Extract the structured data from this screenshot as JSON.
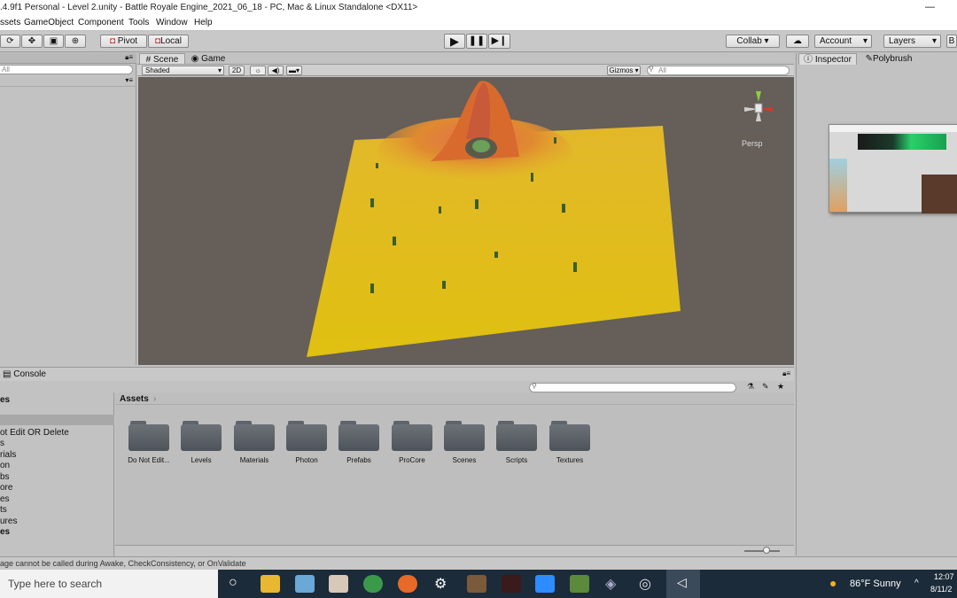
{
  "window": {
    "title": ".4.9f1 Personal - Level 2.unity - Battle Royale Engine_2021_06_18 - PC, Mac & Linux Standalone <DX11>",
    "minimize": "—",
    "maximize": "☐"
  },
  "menu": {
    "items": [
      "ssets",
      "GameObject",
      "Component",
      "Tools",
      "Window",
      "Help"
    ]
  },
  "toolbar": {
    "pivot": "Pivot",
    "local": "Local",
    "collab": "Collab ▾",
    "account": "Account",
    "layers": "Layers",
    "layout": "B"
  },
  "hierarchy": {
    "search_placeholder": "All"
  },
  "scene": {
    "tab_scene": "Scene",
    "tab_game": "Game",
    "shading": "Shaded",
    "mode_2d": "2D",
    "gizmos": "Gizmos",
    "search_placeholder": "All",
    "persp": "Persp"
  },
  "inspector": {
    "tab_inspector": "Inspector",
    "tab_polybrush": "Polybrush"
  },
  "console": {
    "tab": "Console"
  },
  "project": {
    "root": "es",
    "breadcrumb": "Assets",
    "tree": [
      "ot Edit OR Delete",
      "s",
      "rials",
      "on",
      "bs",
      "ore",
      "es",
      "ts",
      "ures",
      "es"
    ],
    "folders": [
      "Do Not Edit...",
      "Levels",
      "Materials",
      "Photon",
      "Prefabs",
      "ProCore",
      "Scenes",
      "Scripts",
      "Textures"
    ]
  },
  "status": {
    "message": "age cannot be called during Awake, CheckConsistency, or OnValidate"
  },
  "taskbar": {
    "search": "Type here to search",
    "weather": "86°F  Sunny",
    "time": "12:07",
    "date": "8/11/2"
  },
  "colors": {
    "scene_bg": "#655e59",
    "terrain_yellow": "#e8c020",
    "terrain_orange": "#e08a30",
    "taskbar": "#1c2b39"
  }
}
